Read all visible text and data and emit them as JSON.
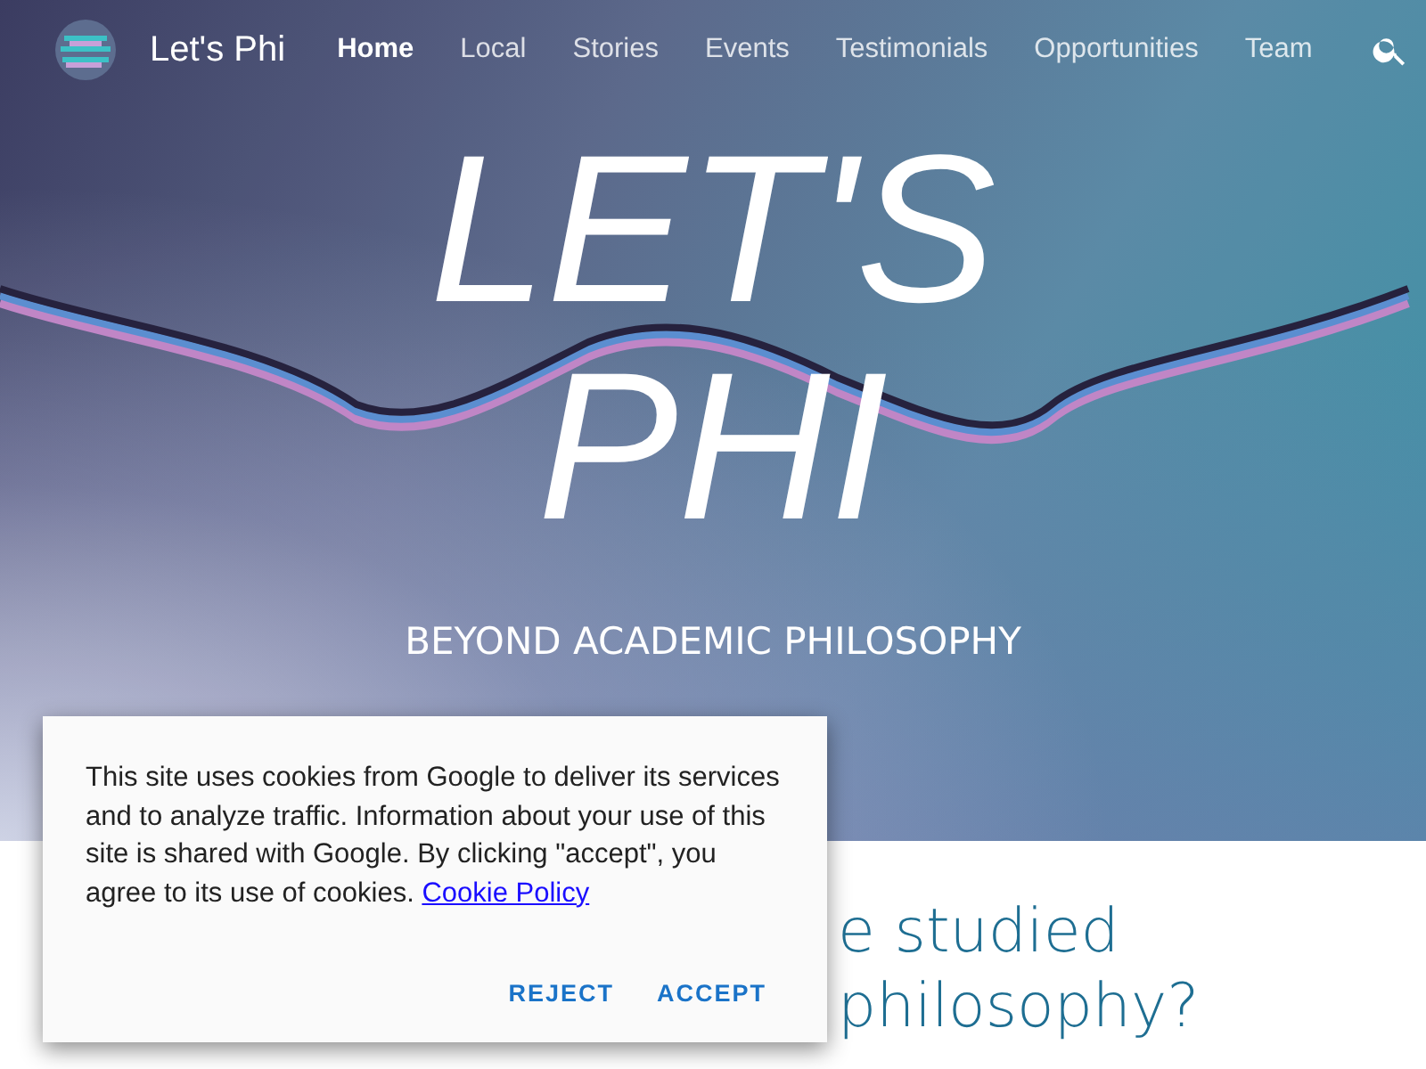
{
  "nav": {
    "site_title": "Let's Phi",
    "items": [
      {
        "label": "Home",
        "selected": true
      },
      {
        "label": "Local",
        "selected": false
      },
      {
        "label": "Stories",
        "selected": false
      },
      {
        "label": "Events",
        "selected": false
      },
      {
        "label": "Testimonials",
        "selected": false
      },
      {
        "label": "Opportunities",
        "selected": false
      },
      {
        "label": "Team",
        "selected": false
      }
    ]
  },
  "hero": {
    "title": "LET'S PHI",
    "subtitle": "BEYOND ACADEMIC PHILOSOPHY"
  },
  "section": {
    "heading": "e studied philosophy?"
  },
  "cookie_dialog": {
    "message": "This site uses cookies from Google to deliver its services and to analyze traffic. Information about your use of this site is shared with Google. By clicking \"accept\", you agree to its use of cookies.",
    "link": "Cookie Policy",
    "buttons": [
      "REJECT",
      "ACCEPT"
    ]
  }
}
